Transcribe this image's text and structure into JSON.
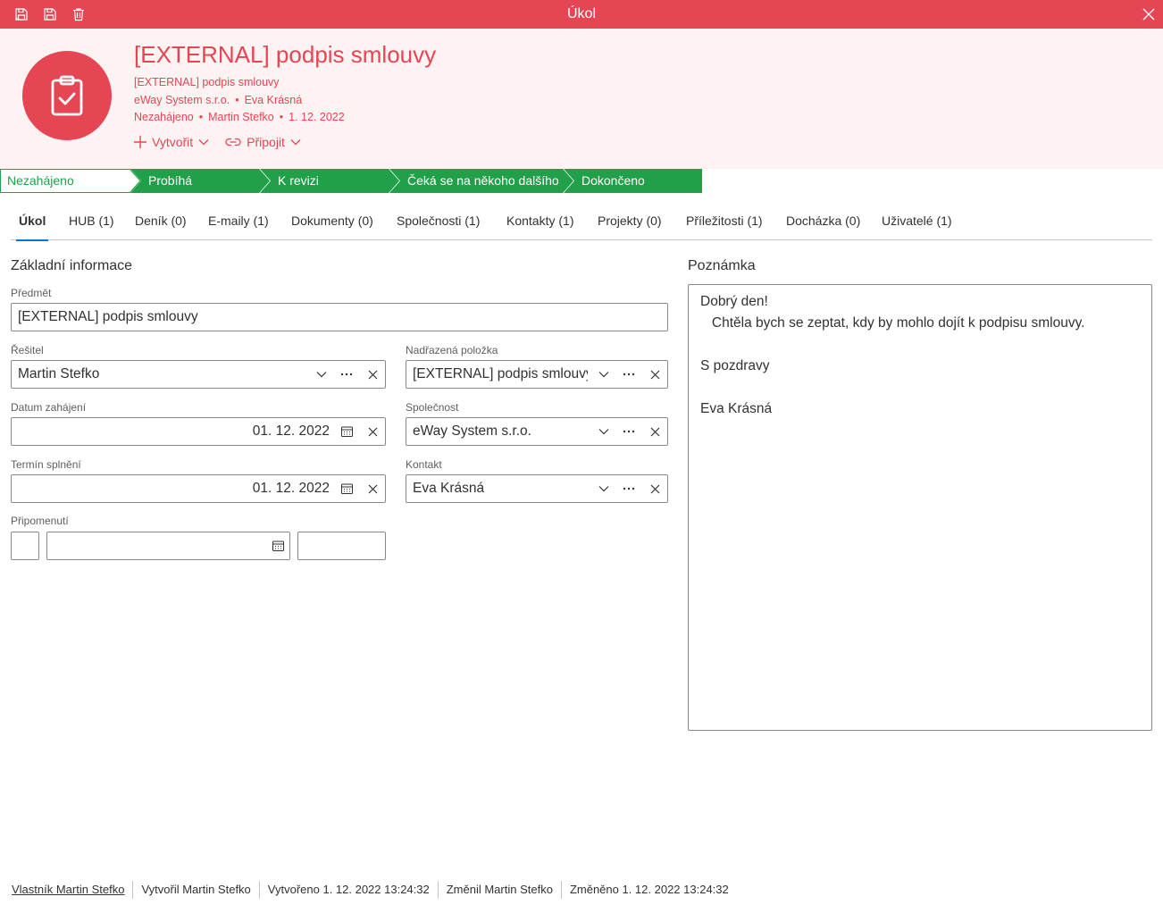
{
  "window": {
    "title": "Úkol"
  },
  "header": {
    "title": "[EXTERNAL] podpis smlouvy",
    "subject_line": "[EXTERNAL] podpis smlouvy",
    "company": "eWay System s.r.o.",
    "contact": "Eva Krásná",
    "state": "Nezahájeno",
    "solver": "Martin Stefko",
    "date": "1. 12. 2022",
    "create_label": "Vytvořit",
    "connect_label": "Připojit"
  },
  "stages": [
    {
      "label": "Nezahájeno",
      "current": true
    },
    {
      "label": "Probíhá"
    },
    {
      "label": "K revizi"
    },
    {
      "label": "Čeká se na někoho dalšího"
    },
    {
      "label": "Dokončeno"
    }
  ],
  "tabs": [
    {
      "label": "Úkol",
      "active": true
    },
    {
      "label": "HUB (1)"
    },
    {
      "label": "Deník (0)"
    },
    {
      "label": "E-maily (1)"
    },
    {
      "label": "Dokumenty (0)"
    },
    {
      "label": "Společnosti (1)"
    },
    {
      "label": "Kontakty (1)"
    },
    {
      "label": "Projekty (0)"
    },
    {
      "label": "Příležitosti (1)"
    },
    {
      "label": "Docházka (0)"
    },
    {
      "label": "Uživatelé (1)"
    }
  ],
  "basic_info": {
    "title": "Základní informace",
    "subject": {
      "label": "Předmět",
      "value": "[EXTERNAL] podpis smlouvy"
    },
    "solver": {
      "label": "Řešitel",
      "value": "Martin Stefko"
    },
    "parent": {
      "label": "Nadřazená položka",
      "value": "[EXTERNAL] podpis smlouvy"
    },
    "start_date": {
      "label": "Datum zahájení",
      "value": "01. 12. 2022"
    },
    "company": {
      "label": "Společnost",
      "value": "eWay System s.r.o."
    },
    "due_date": {
      "label": "Termín splnění",
      "value": "01. 12. 2022"
    },
    "contact": {
      "label": "Kontakt",
      "value": "Eva Krásná"
    },
    "reminder": {
      "label": "Připomenutí"
    }
  },
  "note": {
    "title": "Poznámka",
    "text": "Dobrý den!\n   Chtěla bych se zeptat, kdy by mohlo dojít k podpisu smlouvy.\n\nS pozdravy\n\nEva Krásná"
  },
  "footer": {
    "owner": "Vlastník Martin Stefko",
    "created_by": "Vytvořil Martin Stefko",
    "created": "Vytvořeno 1. 12. 2022 13:24:32",
    "modified_by": "Změnil Martin Stefko",
    "modified": "Změněno 1. 12. 2022 13:24:32"
  },
  "colors": {
    "accent": "#e64553",
    "stage_green": "#21a04a",
    "header_bg": "#fdf3f3",
    "tab_underline": "#0078d4"
  }
}
